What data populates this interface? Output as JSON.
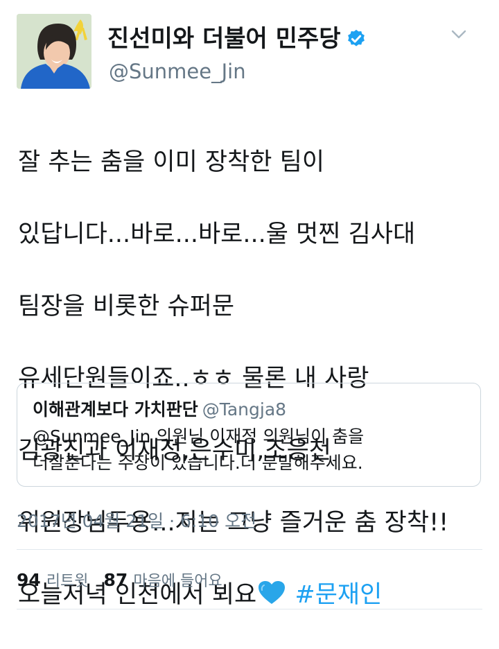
{
  "author": {
    "display_name": "진선미와 더불어 민주당",
    "username": "@Sunmee_Jin",
    "verified": true
  },
  "tweet": {
    "lines": [
      "잘 추는 춤을 이미 장착한 팀이",
      "있답니다...바로...바로...울 멋찐 김사대",
      "팀장을 비롯한 슈퍼문",
      "유세단원들이죠..ㅎㅎ 물론 내 사랑",
      "김광진과 이재정,은수미,조응천",
      "위원장님두용...저는 그냥 즐거운 춤 장착!!",
      "오늘저녁 인천에서 뵈요"
    ],
    "hashtag": "#문재인",
    "emoji": "blue-heart-icon"
  },
  "quote": {
    "name": "이해관계보다 가치판단",
    "handle": "@Tangja8",
    "lines": [
      "@Sunmee_Jin 의원님 이재정 의원님이 춤을",
      "더잘춘다는 주장이 있습니다.더 분발해주세요."
    ]
  },
  "timestamp": "2017년 04월 21일 · 6:10 오전",
  "stats": {
    "retweets_count": "94",
    "retweets_label": "리트윗",
    "likes_count": "87",
    "likes_label": "마음에 들어요"
  },
  "colors": {
    "accent": "#1da1f2",
    "secondary_text": "#657786",
    "border": "#ccd6dd"
  }
}
